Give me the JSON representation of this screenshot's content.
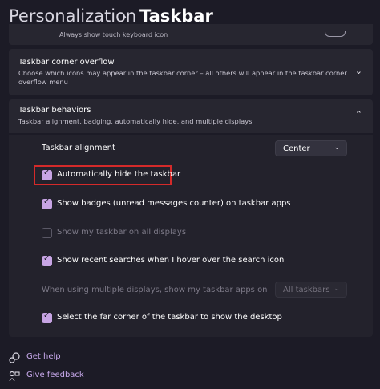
{
  "breadcrumb": {
    "parent": "Personalization",
    "separator": "›",
    "current": "Taskbar"
  },
  "partial_row": {
    "text": "Always show touch keyboard icon"
  },
  "overflow": {
    "title": "Taskbar corner overflow",
    "subtitle": "Choose which icons may appear in the taskbar corner – all others will appear in the taskbar corner overflow menu"
  },
  "behaviors": {
    "title": "Taskbar behaviors",
    "subtitle": "Taskbar alignment, badging, automatically hide, and multiple displays",
    "alignment": {
      "label": "Taskbar alignment",
      "value": "Center"
    },
    "options": [
      {
        "label": "Automatically hide the taskbar",
        "checked": true,
        "enabled": true
      },
      {
        "label": "Show badges (unread messages counter) on taskbar apps",
        "checked": true,
        "enabled": true
      },
      {
        "label": "Show my taskbar on all displays",
        "checked": false,
        "enabled": false
      },
      {
        "label": "Show recent searches when I hover over the search icon",
        "checked": true,
        "enabled": true
      }
    ],
    "multi_display": {
      "label": "When using multiple displays, show my taskbar apps on",
      "value": "All taskbars",
      "enabled": false
    },
    "far_corner": {
      "label": "Select the far corner of the taskbar to show the desktop",
      "checked": true
    }
  },
  "footer": {
    "help": "Get help",
    "feedback": "Give feedback"
  },
  "colors": {
    "accent": "#c7a4e4",
    "highlight_border": "#d42a2a",
    "background": "#1c1b26",
    "card": "#272630"
  },
  "icons": {
    "chevron": "chevron-icon",
    "help": "help-icon",
    "feedback": "feedback-icon"
  }
}
